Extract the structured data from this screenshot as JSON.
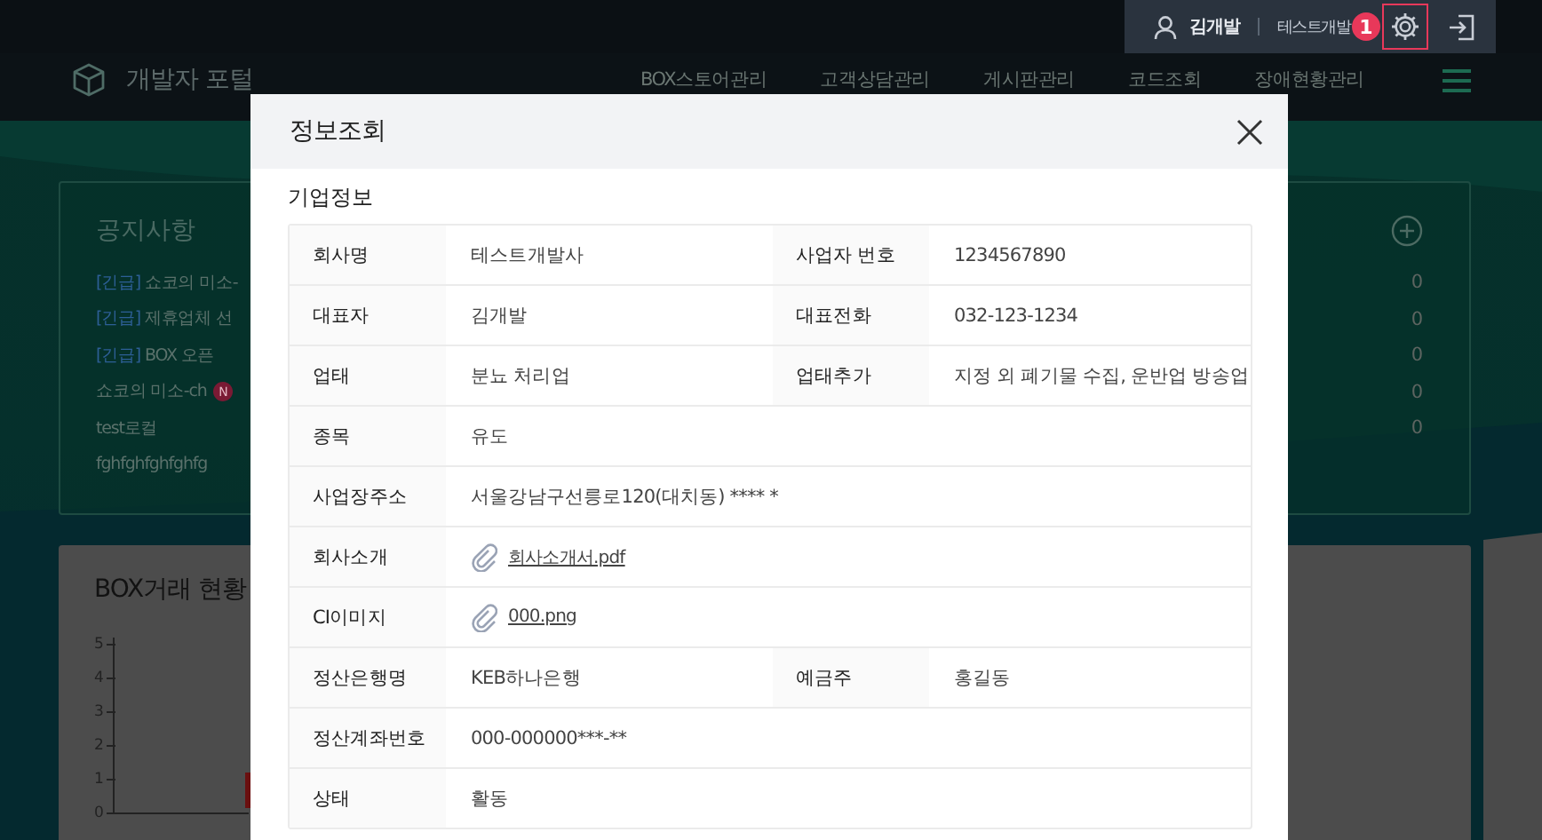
{
  "top_bar": {
    "user_name": "김개발",
    "company": "테스트개발",
    "marker": "1"
  },
  "nav": {
    "logo_text": "개발자 포털",
    "items": [
      "BOX스토어관리",
      "고객상담관리",
      "게시판관리",
      "코드조회",
      "장애현황관리"
    ]
  },
  "notices": {
    "title": "공지사항",
    "items": [
      {
        "tag": "[긴급]",
        "title": "쇼코의 미소-",
        "count": "0"
      },
      {
        "tag": "[긴급]",
        "title": "제휴업체 선",
        "count": "0"
      },
      {
        "tag": "[긴급]",
        "title": "BOX 오픈",
        "count": "0"
      },
      {
        "title": "쇼코의 미소-ch",
        "badge": "N",
        "count": "0"
      },
      {
        "title": "test로컬",
        "count": "0"
      },
      {
        "title": "fghfghfghfghfg"
      }
    ]
  },
  "trade_chart": {
    "title": "BOX거래 현황",
    "y_axis_labels": [
      "5",
      "4",
      "3",
      "2",
      "1",
      "0"
    ]
  },
  "modal": {
    "title": "정보조회",
    "section_title": "기업정보",
    "rows": [
      {
        "kind": "text",
        "label": "회사명",
        "value": "테스트개발사",
        "label2": "사업자 번호",
        "value2": "1234567890"
      },
      {
        "kind": "text",
        "label": "대표자",
        "value": "김개발",
        "label2": "대표전화",
        "value2": "032-123-1234"
      },
      {
        "kind": "text",
        "label": "업태",
        "value": "분뇨 처리업",
        "label2": "업태추가",
        "value2": "지정 외 폐기물 수집, 운반업 방송업"
      },
      {
        "kind": "text",
        "label": "종목",
        "value": "유도"
      },
      {
        "kind": "text",
        "label": "사업장주소",
        "value": "서울강남구선릉로120(대치동)  **** *"
      },
      {
        "kind": "file",
        "label": "회사소개",
        "value": "회사소개서.pdf"
      },
      {
        "kind": "file",
        "label": "CI이미지",
        "value": "000.png"
      },
      {
        "kind": "text",
        "label": "정산은행명",
        "value": "KEB하나은행",
        "label2": "예금주",
        "value2": "홍길동"
      },
      {
        "kind": "text",
        "label": "정산계좌번호",
        "value": "000-000000***-**"
      },
      {
        "kind": "text",
        "label": "상태",
        "value": "활동"
      }
    ]
  }
}
